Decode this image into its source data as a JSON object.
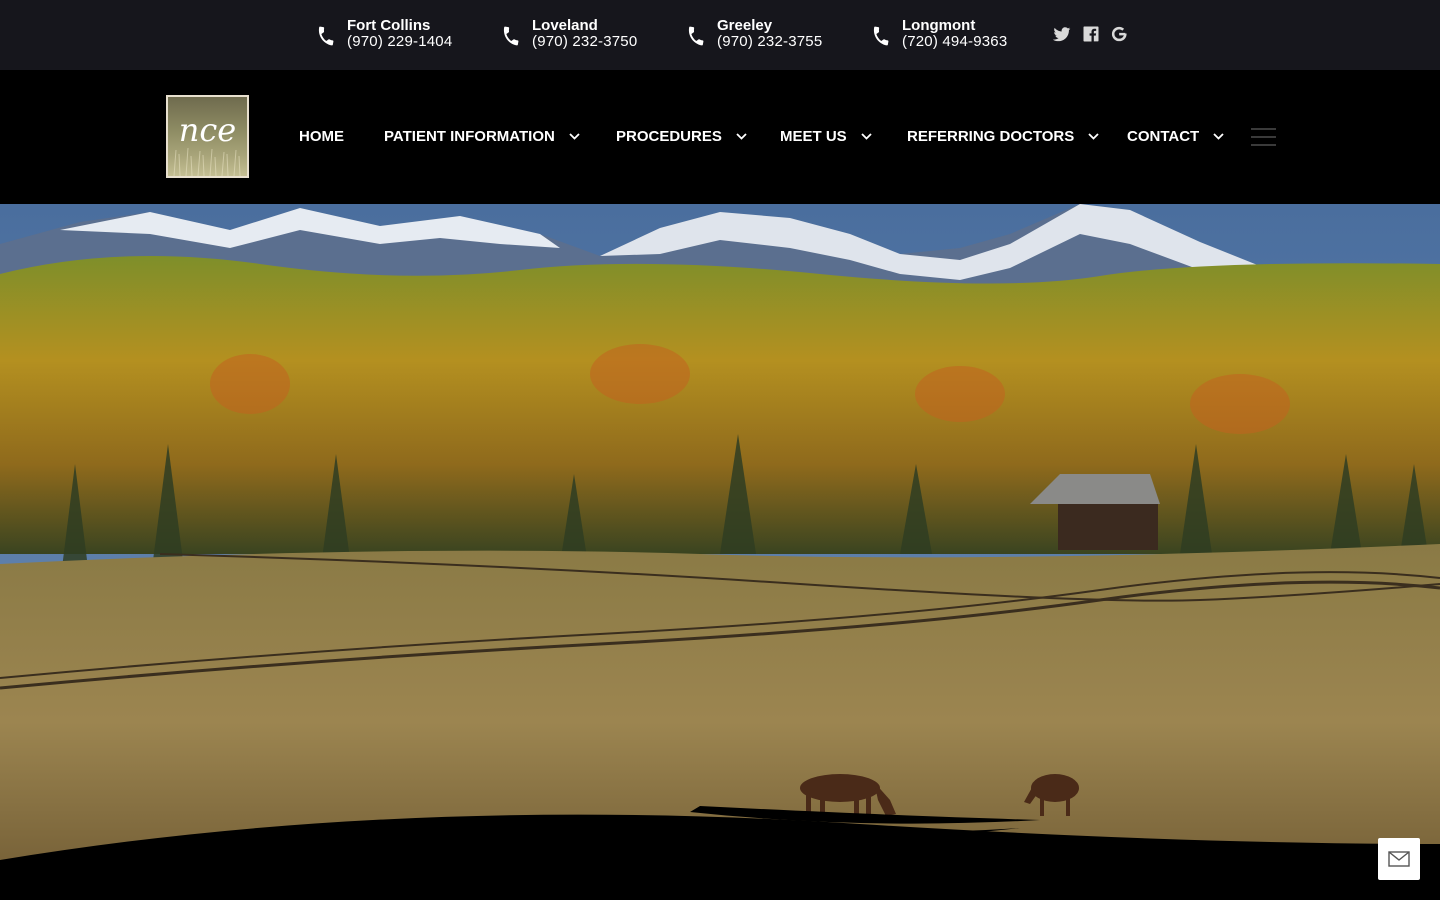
{
  "locations": [
    {
      "city": "Fort Collins",
      "phone": "(970) 229-1404"
    },
    {
      "city": "Loveland",
      "phone": "(970) 232-3750"
    },
    {
      "city": "Greeley",
      "phone": "(970) 232-3755"
    },
    {
      "city": "Longmont",
      "phone": "(720) 494-9363"
    }
  ],
  "social": [
    "twitter-icon",
    "facebook-icon",
    "google-icon"
  ],
  "logo": {
    "text": "nce"
  },
  "nav": {
    "items": [
      {
        "label": "HOME",
        "dropdown": false
      },
      {
        "label": "PATIENT INFORMATION",
        "dropdown": true
      },
      {
        "label": "PROCEDURES",
        "dropdown": true
      },
      {
        "label": "MEET US",
        "dropdown": true
      },
      {
        "label": "REFERRING DOCTORS",
        "dropdown": true
      },
      {
        "label": "CONTACT",
        "dropdown": true
      }
    ]
  },
  "colors": {
    "topbar": "#16161c",
    "nav": "#000000"
  }
}
